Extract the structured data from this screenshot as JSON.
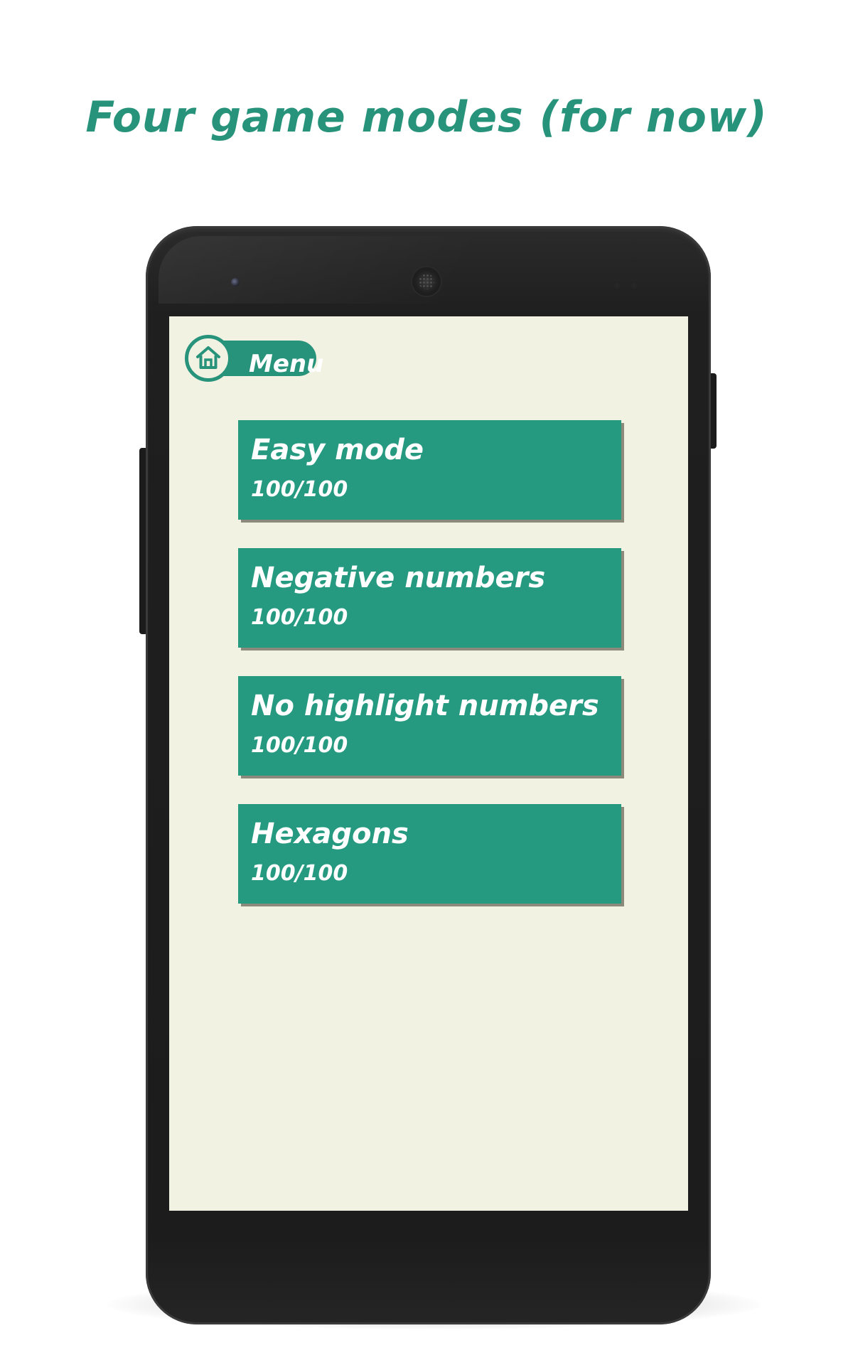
{
  "headline": "Four game modes (for now)",
  "menu": {
    "label": "Menu",
    "icon": "home-icon"
  },
  "modes": [
    {
      "title": "Easy mode",
      "score": "100/100"
    },
    {
      "title": "Negative numbers",
      "score": "100/100"
    },
    {
      "title": "No highlight numbers",
      "score": "100/100"
    },
    {
      "title": "Hexagons",
      "score": "100/100"
    }
  ],
  "colors": {
    "accent": "#27937b",
    "card": "#269a80",
    "screen_background": "#f2f2e3",
    "phone_body": "#1c1c1c"
  }
}
